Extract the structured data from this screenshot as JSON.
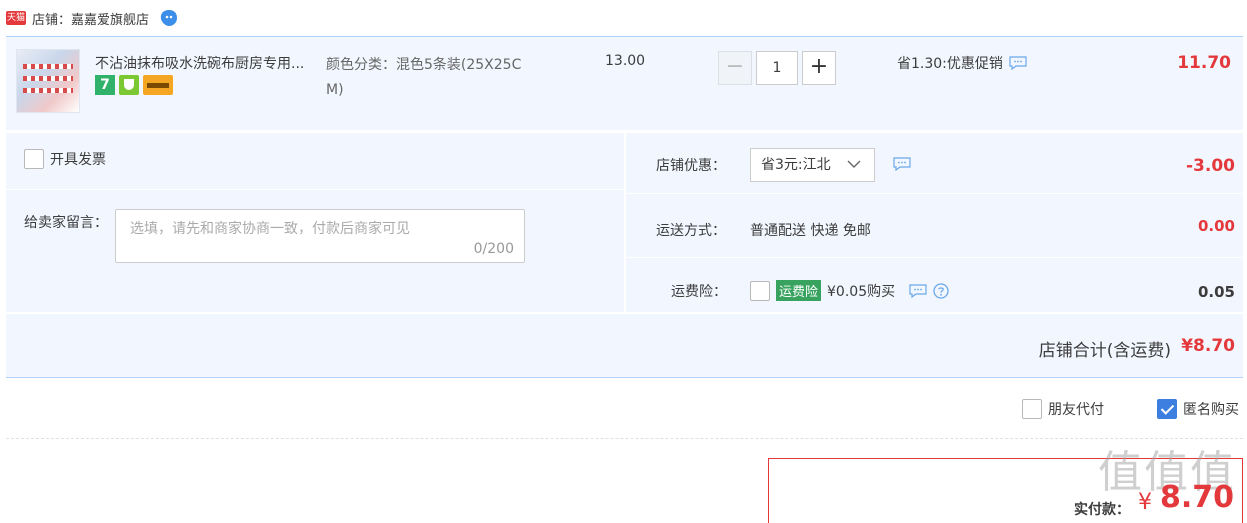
{
  "shop": {
    "badge": "天猫",
    "label": "店铺：嘉嘉爱旗舰店"
  },
  "item": {
    "title": "不沾油抹布吸水洗碗布厨房专用...",
    "sku_line1": "颜色分类：混色5条装(25X25C",
    "sku_line2": "M)",
    "price": "13.00",
    "qty_minus": "−",
    "qty": "1",
    "qty_plus": "+",
    "promo": "省1.30:优惠促销",
    "subtotal": "11.70",
    "badge_7": "7"
  },
  "invoice": {
    "label": "开具发票"
  },
  "message": {
    "label": "给卖家留言：",
    "placeholder": "选填，请先和商家协商一致，付款后商家可见",
    "count": "0/200"
  },
  "shop_coupon": {
    "label": "店铺优惠：",
    "selected": "省3元:江北",
    "amount": "-3.00"
  },
  "shipping": {
    "label": "运送方式：",
    "value": "普通配送 快递 免邮",
    "amount": "0.00"
  },
  "insurance": {
    "label": "运费险：",
    "tag": "运费险",
    "price": "¥0.05购买",
    "amount": "0.05"
  },
  "total": {
    "label": "店铺合计(含运费)",
    "value": "¥8.70"
  },
  "friend_pay": {
    "label": "朋友代付"
  },
  "anon_buy": {
    "label": "匿名购买"
  },
  "pay": {
    "label": "实付款：",
    "symbol": "¥",
    "value": "8.70"
  },
  "watermark": "值值值",
  "colors": {
    "accent_red": "#e4393c",
    "blue_border": "#b2d1ff",
    "panel_bg": "#f2f7ff",
    "check_blue": "#3d7fe0"
  }
}
